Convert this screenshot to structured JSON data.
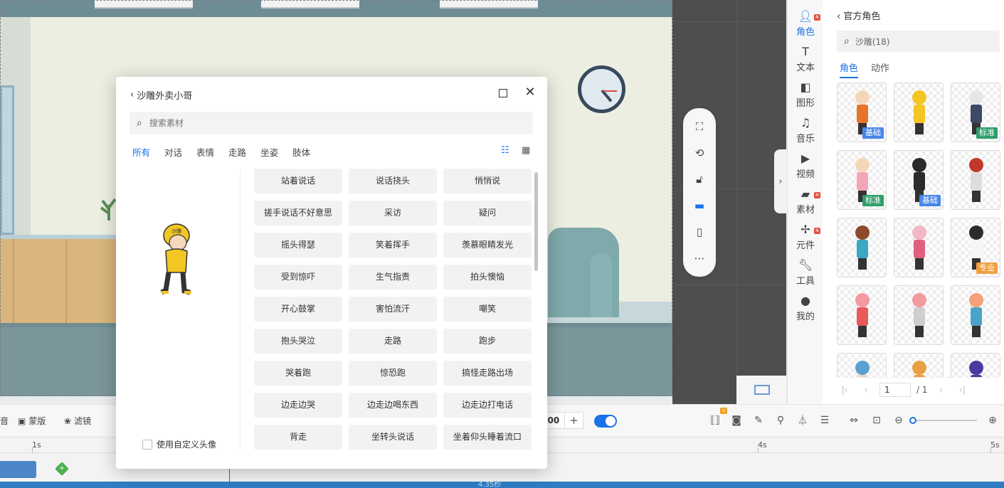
{
  "modal": {
    "back_label": "沙雕外卖小哥",
    "search_placeholder": "搜索素材",
    "tabs": [
      "所有",
      "对话",
      "表情",
      "走路",
      "坐姿",
      "肢体"
    ],
    "active_tab": "所有",
    "custom_avatar_label": "使用自定义头像",
    "actions": [
      "站着说话",
      "说话挠头",
      "悄悄说",
      "搓手说话不好意思",
      "采访",
      "疑问",
      "摇头得瑟",
      "笑着挥手",
      "羡慕眼睛发光",
      "受到惊吓",
      "生气指责",
      "拍头懊恼",
      "开心鼓掌",
      "害怕流汗",
      "嘲笑",
      "抱头哭泣",
      "走路",
      "跑步",
      "哭着跑",
      "惊恐跑",
      "搞怪走路出场",
      "边走边哭",
      "边走边喝东西",
      "边走边打电话",
      "背走",
      "坐转头说话",
      "坐着仰头睡着流口"
    ],
    "preview_hat_text": "沙雕"
  },
  "side_nav": [
    {
      "label": "角色",
      "icon": "person-icon",
      "badge": "N",
      "active": true
    },
    {
      "label": "文本",
      "icon": "text-icon",
      "badge": "",
      "active": false
    },
    {
      "label": "图形",
      "icon": "shape-icon",
      "badge": "",
      "active": false
    },
    {
      "label": "音乐",
      "icon": "music-icon",
      "badge": "",
      "active": false
    },
    {
      "label": "视频",
      "icon": "video-icon",
      "badge": "",
      "active": false
    },
    {
      "label": "素材",
      "icon": "folder-icon",
      "badge": "N",
      "active": false
    },
    {
      "label": "元件",
      "icon": "component-icon",
      "badge": "N",
      "active": false
    },
    {
      "label": "工具",
      "icon": "wrench-icon",
      "badge": "",
      "active": false
    },
    {
      "label": "我的",
      "icon": "user-icon",
      "badge": "",
      "active": false
    }
  ],
  "asset_panel": {
    "back_label": "官方角色",
    "search_value": "沙雕(18)",
    "tabs": [
      "角色",
      "动作"
    ],
    "active_tab": "角色",
    "cards": [
      {
        "tag": "基础",
        "tag_color": "#4a86e8",
        "head": "#f4d6b8",
        "body": "#e8742a"
      },
      {
        "tag": "",
        "tag_color": "",
        "head": "#f3c623",
        "body": "#f3c623"
      },
      {
        "tag": "标准",
        "tag_color": "#2e9e6a",
        "head": "#e6e6e6",
        "body": "#3d4a66"
      },
      {
        "tag": "标准",
        "tag_color": "#2e9e6a",
        "head": "#f4d6b8",
        "body": "#f2a6b8"
      },
      {
        "tag": "基础",
        "tag_color": "#4a86e8",
        "head": "#2b2b2b",
        "body": "#2b2b2b"
      },
      {
        "tag": "",
        "tag_color": "",
        "head": "#c0392b",
        "body": "#dddddd"
      },
      {
        "tag": "",
        "tag_color": "",
        "head": "#8b4a2b",
        "body": "#3aa7c4"
      },
      {
        "tag": "",
        "tag_color": "",
        "head": "#f2b6c6",
        "body": "#e06080"
      },
      {
        "tag": "专业",
        "tag_color": "#f0a040",
        "head": "#2b2b2b",
        "body": "#f5f5f5"
      },
      {
        "tag": "",
        "tag_color": "",
        "head": "#f29aa0",
        "body": "#e85a5a"
      },
      {
        "tag": "",
        "tag_color": "",
        "head": "#f29aa0",
        "body": "#cfcfcf"
      },
      {
        "tag": "",
        "tag_color": "",
        "head": "#f4a07a",
        "body": "#4aa3c8"
      },
      {
        "tag": "",
        "tag_color": "",
        "head": "#5aa0d0",
        "body": "#f4d6b8"
      },
      {
        "tag": "",
        "tag_color": "",
        "head": "#e8a040",
        "body": "#e8a040"
      },
      {
        "tag": "",
        "tag_color": "",
        "head": "#4a3aa0",
        "body": "#4a3aa0"
      }
    ],
    "pager": {
      "page": "1",
      "total": "/ 1"
    }
  },
  "bottom_bar": {
    "left_cut_label": "音",
    "mask_label": "蒙版",
    "filter_label": "滤镜",
    "zoom_value": ".00",
    "zoom_plus": "+",
    "vip_badge": "V"
  },
  "timeline": {
    "ticks": [
      "1s",
      "4s",
      "5s"
    ],
    "track_label": "4.35秒"
  },
  "colors": {
    "accent": "#1a73e8"
  }
}
